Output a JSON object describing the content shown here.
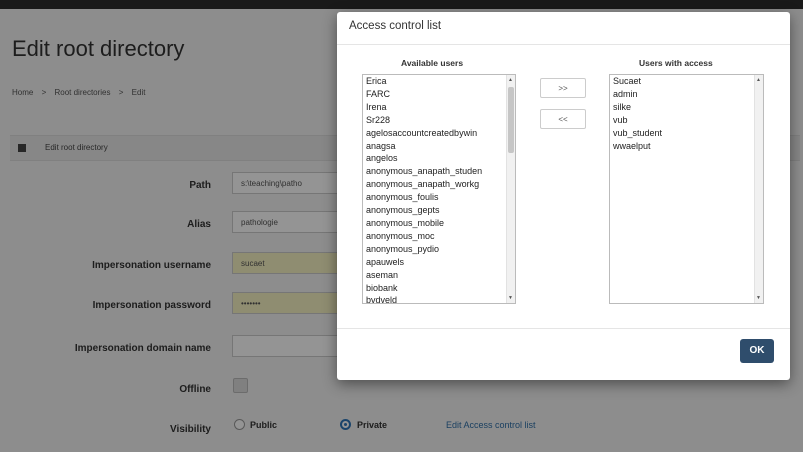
{
  "page": {
    "title": "Edit root directory",
    "breadcrumb": [
      "Home",
      ">",
      "Root directories",
      ">",
      "Edit"
    ],
    "panel_title": "Edit root directory",
    "form": {
      "path": {
        "label": "Path",
        "value": "s:\\teaching\\patho"
      },
      "alias": {
        "label": "Alias",
        "value": "pathologie"
      },
      "imp_user": {
        "label": "Impersonation username",
        "value": "sucaet"
      },
      "imp_pass": {
        "label": "Impersonation password",
        "value": "•••••••"
      },
      "imp_domain": {
        "label": "Impersonation domain name",
        "value": ""
      },
      "offline": {
        "label": "Offline"
      },
      "visibility": {
        "label": "Visibility",
        "public": "Public",
        "private": "Private",
        "acl_link": "Edit Access control list"
      }
    }
  },
  "modal": {
    "title": "Access control list",
    "available_header": "Available users",
    "access_header": "Users with access",
    "available_users": [
      "Erica",
      "FARC",
      "Irena",
      "Sr228",
      "agelosaccountcreatedbywin",
      "anagsa",
      "angelos",
      "anonymous_anapath_studen",
      "anonymous_anapath_workg",
      "anonymous_foulis",
      "anonymous_gepts",
      "anonymous_mobile",
      "anonymous_moc",
      "anonymous_pydio",
      "apauwels",
      "aseman",
      "biobank",
      "bvdveld"
    ],
    "users_with_access": [
      "Sucaet",
      "admin",
      "silke",
      "vub",
      "vub_student",
      "wwaelput"
    ],
    "add_button": ">>",
    "remove_button": "<<",
    "ok_button": "OK"
  }
}
